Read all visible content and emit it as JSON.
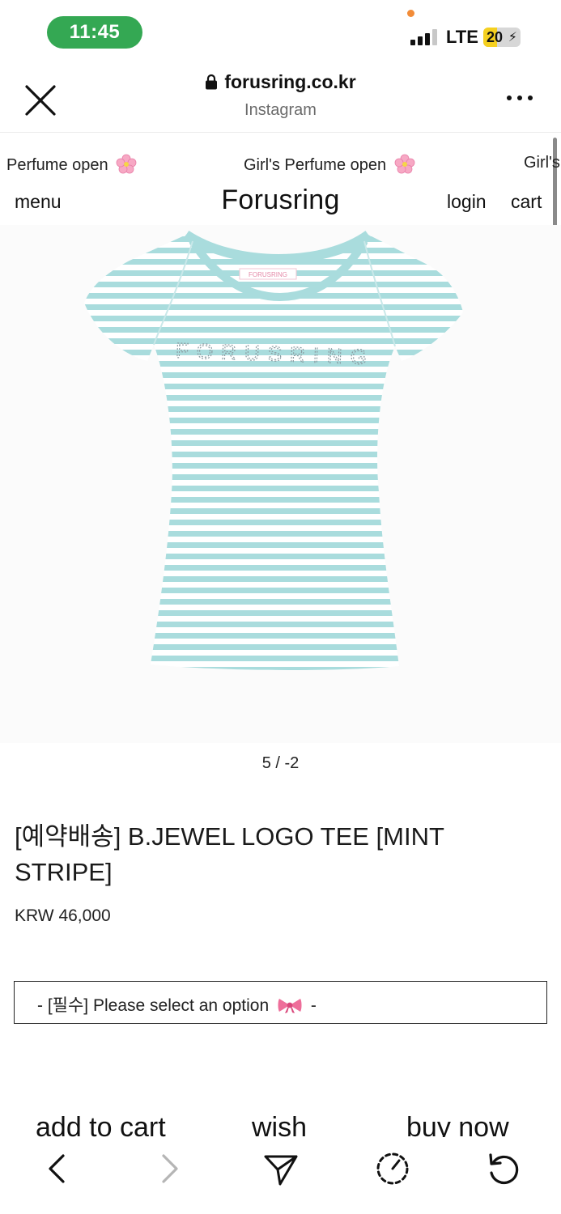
{
  "status_bar": {
    "time": "11:45",
    "network": "LTE",
    "battery_level": "20",
    "battery_fraction": 0.36,
    "accent_time": "#34a853"
  },
  "browser": {
    "url": "forusring.co.kr",
    "subtitle": "Instagram",
    "icons": [
      "close-icon",
      "lock-icon",
      "more-icon"
    ]
  },
  "marquee": {
    "left_text": "Perfume open",
    "center_text": "Girl's Perfume open",
    "right_text": "Girl's"
  },
  "shop_nav": {
    "menu": "menu",
    "brand": "Forusring",
    "login": "login",
    "cart": "cart"
  },
  "product": {
    "image_label": "FORUSRING",
    "collar_tag": "FORUSRING",
    "stripe_color": "#a9dcdd",
    "pager": "5 / -2",
    "title": "[예약배송] B.JEWEL LOGO TEE [MINT STRIPE]",
    "price": "KRW 46,000",
    "option_prefix": "- [필수] Please select an option",
    "option_suffix": "-"
  },
  "actions": {
    "add_to_cart": "add to cart",
    "wish": "wish",
    "buy_now": "buy now"
  },
  "toolbar": {
    "icons": [
      "back-icon",
      "forward-icon",
      "share-icon",
      "speed-icon",
      "reload-icon"
    ]
  }
}
